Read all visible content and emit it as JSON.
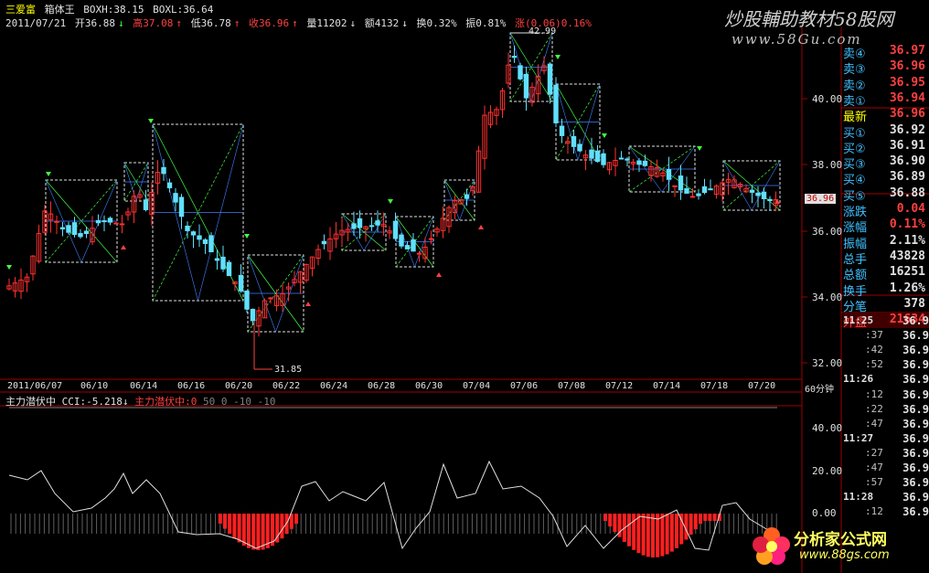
{
  "header": {
    "stock_name": "三爱富",
    "indicator_name": "箱体王",
    "boxh_label": "BOXH:38.15",
    "boxl_label": "BOXL:36.64",
    "date": "2011/07/21",
    "open_label": "开36.88",
    "high_label": "高37.08",
    "low_label": "低36.78",
    "close_label": "收36.96",
    "vol_label": "量11202",
    "amount_label": "额4132",
    "turnover_label": "换0.32%",
    "amplitude_label": "振0.81%",
    "change_label": "涨(0.06)0.16%"
  },
  "watermark": {
    "line1": "炒股輔助教材58股网",
    "line2": "www.58Gu.com",
    "logo_text": "分析家公式网",
    "logo_url": "www.88gs.com"
  },
  "price_axis": {
    "ticks": [
      "40.00",
      "38.00",
      "36.00",
      "34.00",
      "32.00"
    ],
    "current_price_marker": "36.96"
  },
  "date_axis": {
    "ticks": [
      "2011/06/07",
      "06/10",
      "06/14",
      "06/16",
      "06/20",
      "06/22",
      "06/24",
      "06/28",
      "06/30",
      "07/04",
      "07/06",
      "07/08",
      "07/12",
      "07/14",
      "07/18",
      "07/20"
    ],
    "period": "60分钟"
  },
  "annotations": {
    "peak_label": "42.99",
    "trough_label": "31.85"
  },
  "sub_indicator": {
    "name": "主力潜伏中",
    "cci_label": "CCI:-5.218",
    "signal_label": "主力潜伏中:0",
    "levels_label": "50 0 -10 -10",
    "axis_ticks": [
      "40.00",
      "20.00",
      "0.00"
    ]
  },
  "quotes": {
    "sell": [
      {
        "label": "卖④",
        "value": "36.97"
      },
      {
        "label": "卖③",
        "value": "36.96"
      },
      {
        "label": "卖②",
        "value": "36.95"
      },
      {
        "label": "卖①",
        "value": "36.94"
      }
    ],
    "latest": {
      "label": "最新",
      "value": "36.96"
    },
    "buy": [
      {
        "label": "买①",
        "value": "36.92"
      },
      {
        "label": "买②",
        "value": "36.91"
      },
      {
        "label": "买③",
        "value": "36.90"
      },
      {
        "label": "买④",
        "value": "36.89"
      },
      {
        "label": "买⑤",
        "value": "36.88"
      }
    ],
    "stats": [
      {
        "label": "涨跌",
        "value": "0.04",
        "color": "#ff4040"
      },
      {
        "label": "涨幅",
        "value": "0.11%",
        "color": "#ff4040"
      },
      {
        "label": "振幅",
        "value": "2.11%",
        "color": "#e0e0e0"
      },
      {
        "label": "总手",
        "value": "43828",
        "color": "#e0e0e0"
      },
      {
        "label": "总额",
        "value": "16251",
        "color": "#e0e0e0"
      },
      {
        "label": "换手",
        "value": "1.26%",
        "color": "#e0e0e0"
      },
      {
        "label": "分笔",
        "value": "378",
        "color": "#e0e0e0"
      },
      {
        "label": "外盘",
        "value": "21634",
        "color": "#ff4040"
      }
    ]
  },
  "ticks": [
    {
      "time": "11:25",
      "price": "36.9"
    },
    {
      "time": ":37",
      "price": "36.9"
    },
    {
      "time": ":42",
      "price": "36.9"
    },
    {
      "time": ":52",
      "price": "36.9"
    },
    {
      "time": "11:26",
      "price": "36.9"
    },
    {
      "time": ":12",
      "price": "36.9"
    },
    {
      "time": ":22",
      "price": "36.9"
    },
    {
      "time": ":47",
      "price": "36.9"
    },
    {
      "time": "11:27",
      "price": "36.9"
    },
    {
      "time": ":27",
      "price": "36.9"
    },
    {
      "time": ":47",
      "price": "36.9"
    },
    {
      "time": ":57",
      "price": "36.9"
    },
    {
      "time": "11:28",
      "price": "36.9"
    },
    {
      "time": ":12",
      "price": "36.9"
    }
  ]
}
